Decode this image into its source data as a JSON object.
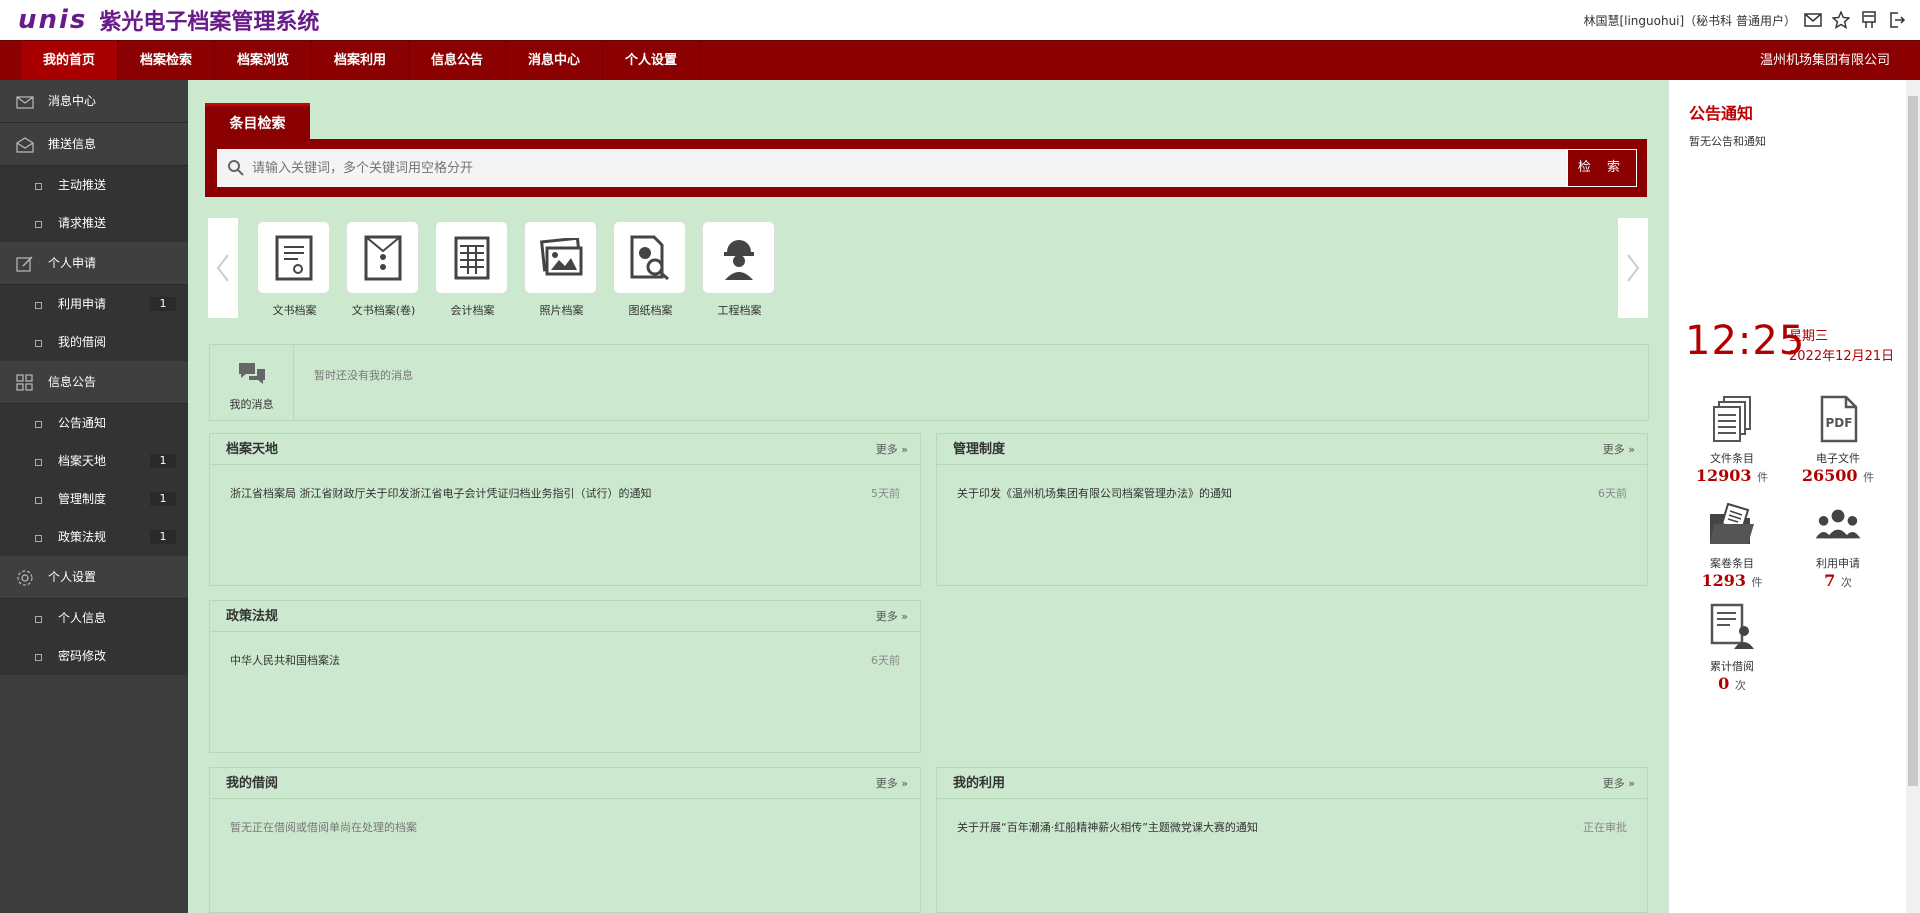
{
  "header": {
    "logo_mark": "unis",
    "title": "紫光电子档案管理系统",
    "user": "林国慧[linguohui]（秘书科 普通用户）"
  },
  "nav": {
    "items": [
      "我的首页",
      "档案检索",
      "档案浏览",
      "档案利用",
      "信息公告",
      "消息中心",
      "个人设置"
    ],
    "company": "温州机场集团有限公司"
  },
  "sidebar": {
    "groups": [
      {
        "label": "消息中心",
        "icon": "mail-icon",
        "items": []
      },
      {
        "label": "推送信息",
        "icon": "envelope-icon",
        "items": [
          {
            "label": "主动推送",
            "badge": ""
          },
          {
            "label": "请求推送",
            "badge": ""
          }
        ]
      },
      {
        "label": "个人申请",
        "icon": "edit-icon",
        "items": [
          {
            "label": "利用申请",
            "badge": "1"
          },
          {
            "label": "我的借阅",
            "badge": ""
          }
        ]
      },
      {
        "label": "信息公告",
        "icon": "grid-icon",
        "items": [
          {
            "label": "公告通知",
            "badge": ""
          },
          {
            "label": "档案天地",
            "badge": "1"
          },
          {
            "label": "管理制度",
            "badge": "1"
          },
          {
            "label": "政策法规",
            "badge": "1"
          }
        ]
      },
      {
        "label": "个人设置",
        "icon": "gear-icon",
        "items": [
          {
            "label": "个人信息",
            "badge": ""
          },
          {
            "label": "密码修改",
            "badge": ""
          }
        ]
      }
    ]
  },
  "search": {
    "tab": "条目检索",
    "placeholder": "请输入关键词，多个关键词用空格分开",
    "button": "检 索"
  },
  "categories": [
    "文书档案",
    "文书档案(卷)",
    "会计档案",
    "照片档案",
    "图纸档案",
    "工程档案"
  ],
  "my_messages": {
    "label": "我的消息",
    "text": "暂时还没有我的消息"
  },
  "panels": {
    "more": "更多",
    "archive_world": {
      "title": "档案天地",
      "row": "浙江省档案局 浙江省财政厅关于印发浙江省电子会计凭证归档业务指引（试行）的通知",
      "time": "5天前"
    },
    "rules": {
      "title": "管理制度",
      "row": "关于印发《温州机场集团有限公司档案管理办法》的通知",
      "time": "6天前"
    },
    "policy": {
      "title": "政策法规",
      "row": "中华人民共和国档案法",
      "time": "6天前"
    },
    "borrow": {
      "title": "我的借阅",
      "row": "暂无正在借阅或借阅单尚在处理的档案"
    },
    "usage": {
      "title": "我的利用",
      "row": "关于开展“百年潮涌·红船精神薪火相传”主题微党课大赛的通知",
      "time": "正在审批"
    }
  },
  "right": {
    "announce_title": "公告通知",
    "announce_text": "暂无公告和通知",
    "time": "12:25",
    "weekday": "星期三",
    "date": "2022年12月21日",
    "stats": [
      {
        "label": "文件条目",
        "value": "12903",
        "unit": "件"
      },
      {
        "label": "电子文件",
        "value": "26500",
        "unit": "件"
      },
      {
        "label": "案卷条目",
        "value": "1293",
        "unit": "件"
      },
      {
        "label": "利用申请",
        "value": "7",
        "unit": "次"
      },
      {
        "label": "累计借阅",
        "value": "0",
        "unit": "次"
      }
    ],
    "pdf_text": "PDF"
  },
  "colors": {
    "brand_purple": "#6a1b8a",
    "nav_red": "#8b0000",
    "main_green": "#cce8ce",
    "accent_red": "#b00000"
  }
}
